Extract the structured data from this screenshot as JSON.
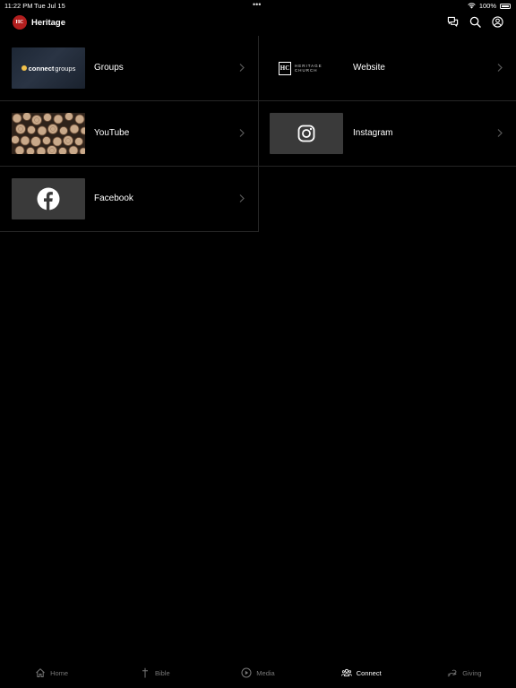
{
  "status": {
    "time": "11:22 PM",
    "date": "Tue Jul 15",
    "dots": "•••",
    "battery": "100%"
  },
  "header": {
    "title": "Heritage",
    "logo_text": "HC"
  },
  "items": [
    {
      "label": "Groups",
      "thumb_text_bold": "connect",
      "thumb_text_thin": "groups"
    },
    {
      "label": "Website",
      "thumb_logo": "HC",
      "thumb_text": "HERITAGE CHURCH"
    },
    {
      "label": "YouTube"
    },
    {
      "label": "Instagram"
    },
    {
      "label": "Facebook"
    }
  ],
  "tabs": [
    {
      "label": "Home",
      "icon": "home-icon"
    },
    {
      "label": "Bible",
      "icon": "cross-icon"
    },
    {
      "label": "Media",
      "icon": "play-icon"
    },
    {
      "label": "Connect",
      "icon": "people-icon",
      "active": true
    },
    {
      "label": "Giving",
      "icon": "giving-icon"
    }
  ],
  "colors": {
    "background": "#000000",
    "divider": "#262626",
    "inactive_tab": "#777777",
    "brand": "#b21e1e"
  }
}
